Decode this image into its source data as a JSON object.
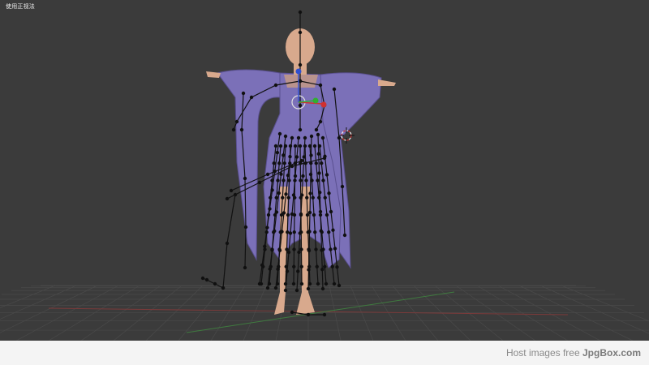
{
  "viewport": {
    "label": "使用正视法",
    "background": "#3b3b3b",
    "grid_color": "#4a4a4a",
    "x_axis_color": "#7a3a3a",
    "y_axis_color": "#3f7a3f"
  },
  "scene": {
    "object": "rigged-character-armature",
    "robe_color": "#7b70b8",
    "skin_color": "#d8a98d",
    "bone_color": "#111111",
    "gizmo": {
      "x_color": "#d03030",
      "y_color": "#30b030",
      "z_color": "#3050d0",
      "ring_color": "#e0e0e0"
    },
    "cursor_icon": "3d-cursor-icon"
  },
  "watermark": {
    "prefix": "Host images free",
    "brand": "JpgBox.com"
  }
}
